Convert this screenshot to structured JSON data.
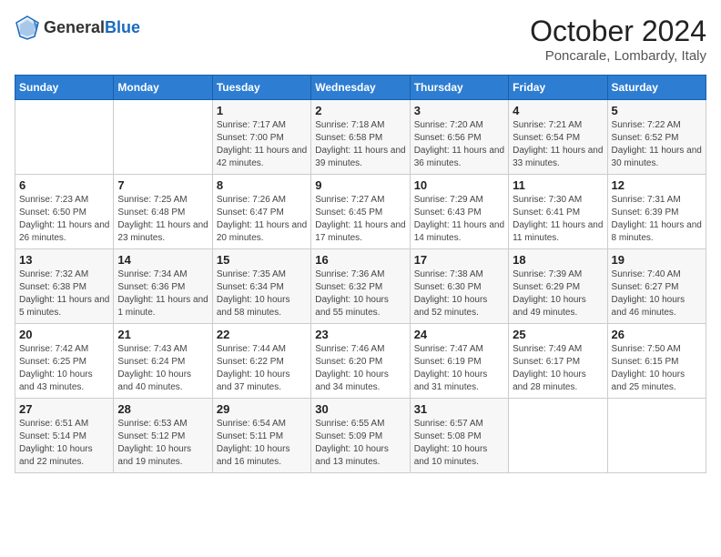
{
  "header": {
    "logo_general": "General",
    "logo_blue": "Blue",
    "month": "October 2024",
    "location": "Poncarale, Lombardy, Italy"
  },
  "days_of_week": [
    "Sunday",
    "Monday",
    "Tuesday",
    "Wednesday",
    "Thursday",
    "Friday",
    "Saturday"
  ],
  "weeks": [
    [
      {
        "day": "",
        "info": ""
      },
      {
        "day": "",
        "info": ""
      },
      {
        "day": "1",
        "info": "Sunrise: 7:17 AM\nSunset: 7:00 PM\nDaylight: 11 hours and 42 minutes."
      },
      {
        "day": "2",
        "info": "Sunrise: 7:18 AM\nSunset: 6:58 PM\nDaylight: 11 hours and 39 minutes."
      },
      {
        "day": "3",
        "info": "Sunrise: 7:20 AM\nSunset: 6:56 PM\nDaylight: 11 hours and 36 minutes."
      },
      {
        "day": "4",
        "info": "Sunrise: 7:21 AM\nSunset: 6:54 PM\nDaylight: 11 hours and 33 minutes."
      },
      {
        "day": "5",
        "info": "Sunrise: 7:22 AM\nSunset: 6:52 PM\nDaylight: 11 hours and 30 minutes."
      }
    ],
    [
      {
        "day": "6",
        "info": "Sunrise: 7:23 AM\nSunset: 6:50 PM\nDaylight: 11 hours and 26 minutes."
      },
      {
        "day": "7",
        "info": "Sunrise: 7:25 AM\nSunset: 6:48 PM\nDaylight: 11 hours and 23 minutes."
      },
      {
        "day": "8",
        "info": "Sunrise: 7:26 AM\nSunset: 6:47 PM\nDaylight: 11 hours and 20 minutes."
      },
      {
        "day": "9",
        "info": "Sunrise: 7:27 AM\nSunset: 6:45 PM\nDaylight: 11 hours and 17 minutes."
      },
      {
        "day": "10",
        "info": "Sunrise: 7:29 AM\nSunset: 6:43 PM\nDaylight: 11 hours and 14 minutes."
      },
      {
        "day": "11",
        "info": "Sunrise: 7:30 AM\nSunset: 6:41 PM\nDaylight: 11 hours and 11 minutes."
      },
      {
        "day": "12",
        "info": "Sunrise: 7:31 AM\nSunset: 6:39 PM\nDaylight: 11 hours and 8 minutes."
      }
    ],
    [
      {
        "day": "13",
        "info": "Sunrise: 7:32 AM\nSunset: 6:38 PM\nDaylight: 11 hours and 5 minutes."
      },
      {
        "day": "14",
        "info": "Sunrise: 7:34 AM\nSunset: 6:36 PM\nDaylight: 11 hours and 1 minute."
      },
      {
        "day": "15",
        "info": "Sunrise: 7:35 AM\nSunset: 6:34 PM\nDaylight: 10 hours and 58 minutes."
      },
      {
        "day": "16",
        "info": "Sunrise: 7:36 AM\nSunset: 6:32 PM\nDaylight: 10 hours and 55 minutes."
      },
      {
        "day": "17",
        "info": "Sunrise: 7:38 AM\nSunset: 6:30 PM\nDaylight: 10 hours and 52 minutes."
      },
      {
        "day": "18",
        "info": "Sunrise: 7:39 AM\nSunset: 6:29 PM\nDaylight: 10 hours and 49 minutes."
      },
      {
        "day": "19",
        "info": "Sunrise: 7:40 AM\nSunset: 6:27 PM\nDaylight: 10 hours and 46 minutes."
      }
    ],
    [
      {
        "day": "20",
        "info": "Sunrise: 7:42 AM\nSunset: 6:25 PM\nDaylight: 10 hours and 43 minutes."
      },
      {
        "day": "21",
        "info": "Sunrise: 7:43 AM\nSunset: 6:24 PM\nDaylight: 10 hours and 40 minutes."
      },
      {
        "day": "22",
        "info": "Sunrise: 7:44 AM\nSunset: 6:22 PM\nDaylight: 10 hours and 37 minutes."
      },
      {
        "day": "23",
        "info": "Sunrise: 7:46 AM\nSunset: 6:20 PM\nDaylight: 10 hours and 34 minutes."
      },
      {
        "day": "24",
        "info": "Sunrise: 7:47 AM\nSunset: 6:19 PM\nDaylight: 10 hours and 31 minutes."
      },
      {
        "day": "25",
        "info": "Sunrise: 7:49 AM\nSunset: 6:17 PM\nDaylight: 10 hours and 28 minutes."
      },
      {
        "day": "26",
        "info": "Sunrise: 7:50 AM\nSunset: 6:15 PM\nDaylight: 10 hours and 25 minutes."
      }
    ],
    [
      {
        "day": "27",
        "info": "Sunrise: 6:51 AM\nSunset: 5:14 PM\nDaylight: 10 hours and 22 minutes."
      },
      {
        "day": "28",
        "info": "Sunrise: 6:53 AM\nSunset: 5:12 PM\nDaylight: 10 hours and 19 minutes."
      },
      {
        "day": "29",
        "info": "Sunrise: 6:54 AM\nSunset: 5:11 PM\nDaylight: 10 hours and 16 minutes."
      },
      {
        "day": "30",
        "info": "Sunrise: 6:55 AM\nSunset: 5:09 PM\nDaylight: 10 hours and 13 minutes."
      },
      {
        "day": "31",
        "info": "Sunrise: 6:57 AM\nSunset: 5:08 PM\nDaylight: 10 hours and 10 minutes."
      },
      {
        "day": "",
        "info": ""
      },
      {
        "day": "",
        "info": ""
      }
    ]
  ]
}
